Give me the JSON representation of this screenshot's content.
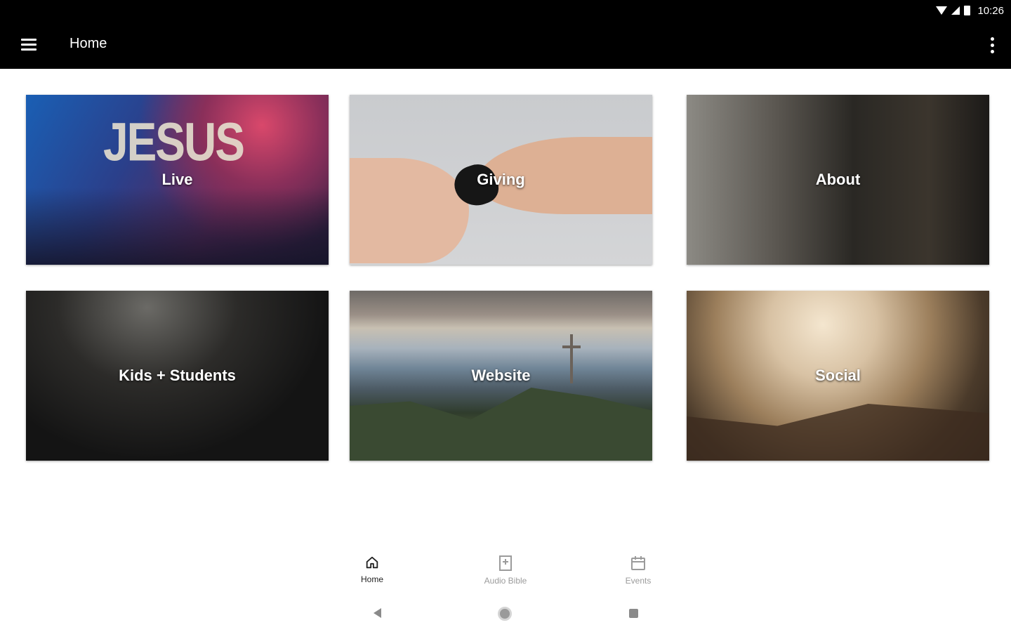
{
  "status_bar": {
    "time": "10:26",
    "icons": [
      "wifi-icon",
      "signal-icon",
      "battery-icon"
    ]
  },
  "toolbar": {
    "title": "Home",
    "menu_icon": "hamburger-menu-icon",
    "more_icon": "more-vert-icon"
  },
  "tiles": [
    {
      "label": "Live",
      "image_text": "JESUS"
    },
    {
      "label": "Giving"
    },
    {
      "label": "About"
    },
    {
      "label": "Kids + Students"
    },
    {
      "label": "Website"
    },
    {
      "label": "Social"
    }
  ],
  "bottom_nav": {
    "items": [
      {
        "label": "Home",
        "icon": "home-icon",
        "active": true
      },
      {
        "label": "Audio Bible",
        "icon": "bible-icon",
        "active": false
      },
      {
        "label": "Events",
        "icon": "calendar-icon",
        "active": false
      }
    ]
  },
  "system_nav": [
    "back-icon",
    "home-circle-icon",
    "recents-icon"
  ],
  "colors": {
    "toolbar": "#000000",
    "nav_active": "#222222",
    "nav_inactive": "#9b9b9b"
  }
}
